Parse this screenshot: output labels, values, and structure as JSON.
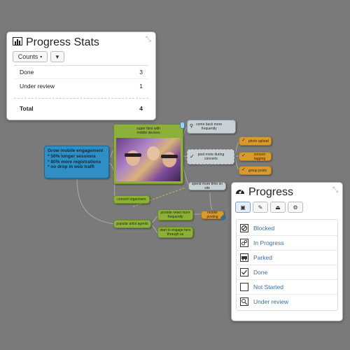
{
  "stats": {
    "title": "Progress Stats",
    "counts_button": "Counts",
    "rows": [
      {
        "label": "Done",
        "value": "3"
      },
      {
        "label": "Under review",
        "value": "1"
      }
    ],
    "total_label": "Total",
    "total_value": "4"
  },
  "mindmap": {
    "root_lines": [
      "Grow mobile engagement",
      "* 50% longer sessions",
      "* 80% more registrations",
      "* no drop in web traffi"
    ],
    "image_node_label": "super fans with\nmobile devices",
    "nodes": {
      "concert_organisers": "concert organisers",
      "popular_artist_agents": "popular artist agents",
      "provide_news": "provide news more\nfrequently",
      "start_engage": "start to engage fans\nthrough us",
      "spend_more_time": "spend more time on site",
      "mobile_posting": "mobile posting",
      "come_back": "come back more\nfrequently",
      "post_more": "post more during\nconcerts",
      "photo_upload": "photo upload",
      "concert_tagging": "concert tagging",
      "group_posts": "group posts"
    }
  },
  "progress": {
    "title": "Progress",
    "items": [
      {
        "label": "Blocked",
        "icon": "blocked-icon"
      },
      {
        "label": "In Progress",
        "icon": "gears-icon"
      },
      {
        "label": "Parked",
        "icon": "car-icon"
      },
      {
        "label": "Done",
        "icon": "check-icon"
      },
      {
        "label": "Not Started",
        "icon": "empty-box-icon"
      },
      {
        "label": "Under review",
        "icon": "magnifier-icon"
      }
    ]
  },
  "colors": {
    "background": "#7a7a7a",
    "link": "#3a6ea5",
    "node_green": "#8db03a",
    "node_blue": "#2f8fc4",
    "node_orange": "#d89a2b"
  }
}
